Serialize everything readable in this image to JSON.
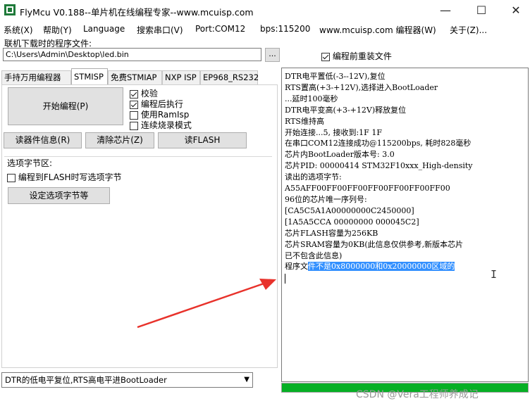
{
  "window": {
    "title": "FlyMcu V0.188--单片机在线编程专家--www.mcuisp.com",
    "minimize": "—",
    "maximize": "☐",
    "close": "✕"
  },
  "menu": {
    "items": [
      "系统(X)",
      "帮助(Y)",
      "Language",
      "搜索串口(V)",
      "Port:COM12",
      "bps:115200",
      "www.mcuisp.com 编程器(W)",
      "关于(Z)..."
    ]
  },
  "file": {
    "label": "联机下载时的程序文件:",
    "path": "C:\\Users\\Admin\\Desktop\\led.bin",
    "browse": "...",
    "reload_label": "编程前重装文件",
    "reload_checked": true
  },
  "tabs": [
    "手持万用编程器",
    "STMISP",
    "免费STMIAP",
    "NXP ISP",
    "EP968_RS232"
  ],
  "active_tab": "STMISP",
  "stmisp": {
    "start_button": "开始编程(P)",
    "options": [
      {
        "label": "校验",
        "checked": true
      },
      {
        "label": "编程后执行",
        "checked": true
      },
      {
        "label": "使用RamIsp",
        "checked": false
      },
      {
        "label": "连续烧录模式",
        "checked": false
      }
    ],
    "read_info_button": "读器件信息(R)",
    "erase_button": "清除芯片(Z)",
    "read_flash_button": "读FLASH",
    "option_group_title": "选项字节区:",
    "option_write_label": "编程到FLASH时写选项字节",
    "option_write_checked": false,
    "set_option_button": "设定选项字节等"
  },
  "reset_mode": "DTR的低电平复位,RTS高电平进BootLoader",
  "log": {
    "lines": [
      "DTR电平置低(-3--12V),复位",
      "RTS置高(+3-+12V),选择进入BootLoader",
      "...延时100毫秒",
      "DTR电平变高(+3-+12V)释放复位",
      "RTS维持高",
      "开始连接...5, 接收到:1F 1F",
      "在串口COM12连接成功@115200bps, 耗时828毫秒",
      "芯片内BootLoader版本号: 3.0",
      "芯片PID: 00000414  STM32F10xxx_High-density",
      "读出的选项字节:",
      "A55AFF00FF00FF00FF00FF00FF00FF00",
      "96位的芯片唯一序列号:",
      "[CA5C5A1A00000000C2450000]",
      "[1A5A5CCA 00000000 000045C2]",
      "芯片FLASH容量为256KB",
      "芯片SRAM容量为0KB(此信息仅供参考,新版本芯片",
      "已不包含此信息)"
    ],
    "last_line_normal": "程序文",
    "last_line_selected": "件不是0x8000000和0x20000000区域的"
  },
  "progress_percent": 100,
  "watermark": "CSDN @Vera工程师养成记",
  "colors": {
    "progress": "#06b025",
    "selection": "#3390ff",
    "arrow": "#e8322b"
  }
}
